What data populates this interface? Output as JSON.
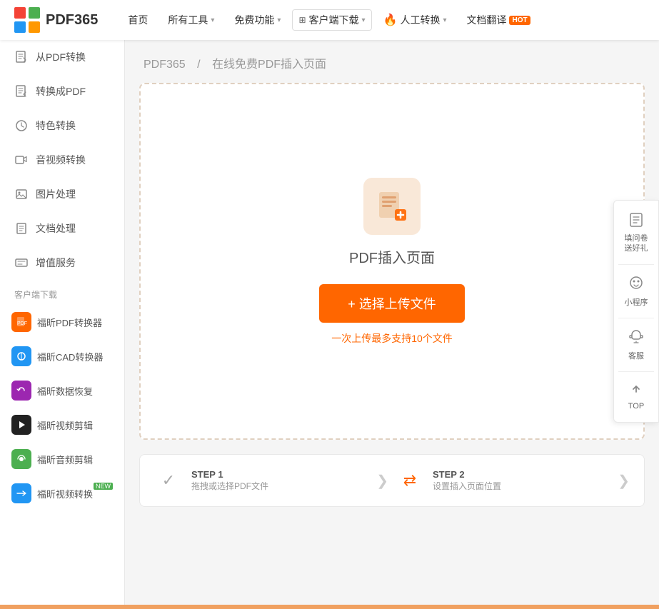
{
  "header": {
    "logo_text": "PDF365",
    "nav_items": [
      {
        "label": "首页",
        "has_arrow": false
      },
      {
        "label": "所有工具",
        "has_arrow": true
      },
      {
        "label": "免费功能",
        "has_arrow": true
      },
      {
        "label": "客户端下载",
        "has_arrow": true
      },
      {
        "label": "人工转换",
        "has_arrow": true
      },
      {
        "label": "文档翻译",
        "has_arrow": false,
        "badge": "HOT"
      }
    ]
  },
  "sidebar": {
    "menu_items": [
      {
        "icon": "📄",
        "label": "从PDF转换"
      },
      {
        "icon": "📝",
        "label": "转换成PDF"
      },
      {
        "icon": "🛡",
        "label": "特色转换"
      },
      {
        "icon": "🎬",
        "label": "音视频转换"
      },
      {
        "icon": "🖼",
        "label": "图片处理"
      },
      {
        "icon": "📋",
        "label": "文档处理"
      },
      {
        "icon": "☰",
        "label": "增值服务"
      }
    ],
    "section_label": "客户端下载",
    "apps": [
      {
        "name": "福昕PDF转换器",
        "color": "#f60",
        "badge": null
      },
      {
        "name": "福昕CAD转换器",
        "color": "#2196F3",
        "badge": null
      },
      {
        "name": "福昕数据恢复",
        "color": "#9C27B0",
        "badge": null
      },
      {
        "name": "福昕视频剪辑",
        "color": "#333",
        "badge": "fire"
      },
      {
        "name": "福昕音频剪辑",
        "color": "#4CAF50",
        "badge": null
      },
      {
        "name": "福昕视频转换",
        "color": "#2196F3",
        "badge": "NEW"
      }
    ]
  },
  "main": {
    "breadcrumb_home": "PDF365",
    "breadcrumb_sep": "/",
    "breadcrumb_page": "在线免费PDF插入页面",
    "upload_title": "PDF插入页面",
    "upload_btn_label": "+ 选择上传文件",
    "upload_hint": "一次上传最多支持10个文件"
  },
  "steps": [
    {
      "num": "STEP 1",
      "desc": "拖拽或选择PDF文件",
      "icon_done": true
    },
    {
      "num": "STEP 2",
      "desc": "设置插入页面位置",
      "icon_done": false
    }
  ],
  "right_panel": [
    {
      "icon": "📋",
      "label": "填问卷\n送好礼"
    },
    {
      "icon": "⚙",
      "label": "小程序"
    },
    {
      "icon": "🎧",
      "label": "客服"
    },
    {
      "icon": "▲",
      "label": "TOP"
    }
  ]
}
